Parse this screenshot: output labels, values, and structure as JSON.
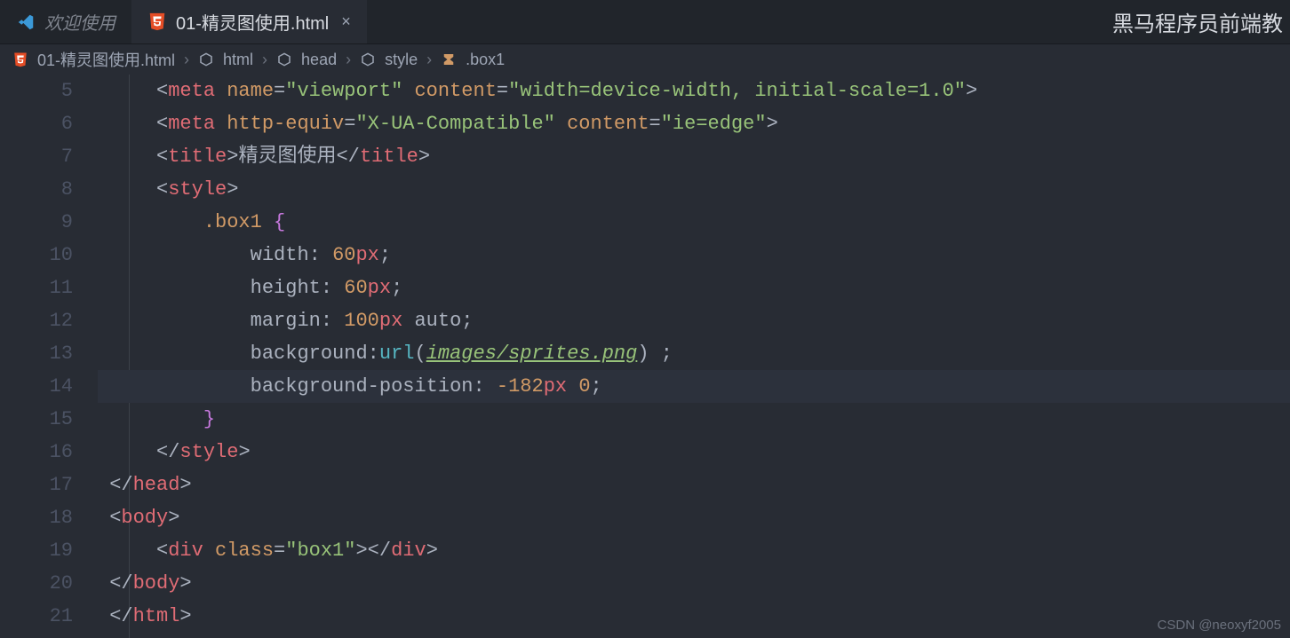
{
  "tabs": {
    "inactive": {
      "label": "欢迎使用"
    },
    "active": {
      "label": "01-精灵图使用.html"
    }
  },
  "header_title": "黑马程序员前端教",
  "breadcrumb": {
    "file": "01-精灵图使用.html",
    "path": [
      "html",
      "head",
      "style",
      ".box1"
    ]
  },
  "gutter": [
    "5",
    "6",
    "7",
    "8",
    "9",
    "10",
    "11",
    "12",
    "13",
    "14",
    "15",
    "16",
    "17",
    "18",
    "19",
    "20",
    "21"
  ],
  "code": {
    "l5": {
      "tag": "meta",
      "a1": "name",
      "v1": "\"viewport\"",
      "a2": "content",
      "v2": "\"width=device-width, initial-scale=1.0\""
    },
    "l6": {
      "tag": "meta",
      "a1": "http-equiv",
      "v1": "\"X-UA-Compatible\"",
      "a2": "content",
      "v2": "\"ie=edge\""
    },
    "l7": {
      "open": "title",
      "text": "精灵图使用",
      "close": "title"
    },
    "l8": {
      "open": "style"
    },
    "l9": {
      "sel": ".box1"
    },
    "l10": {
      "prop": "width",
      "val": "60",
      "unit": "px"
    },
    "l11": {
      "prop": "height",
      "val": "60",
      "unit": "px"
    },
    "l12": {
      "prop": "margin",
      "val": "100",
      "unit": "px",
      "extra": "auto"
    },
    "l13": {
      "prop": "background",
      "fn": "url",
      "arg": "images/sprites.png"
    },
    "l14": {
      "prop": "background-position",
      "v1": "-182",
      "u1": "px",
      "v2": "0"
    },
    "l15": {},
    "l16": {
      "close": "style"
    },
    "l17": {
      "close": "head"
    },
    "l18": {
      "open": "body"
    },
    "l19": {
      "tag": "div",
      "attr": "class",
      "val": "\"box1\"",
      "close": "div"
    },
    "l20": {
      "close": "body"
    },
    "l21": {
      "close": "html"
    }
  },
  "watermark": "CSDN @neoxyf2005"
}
